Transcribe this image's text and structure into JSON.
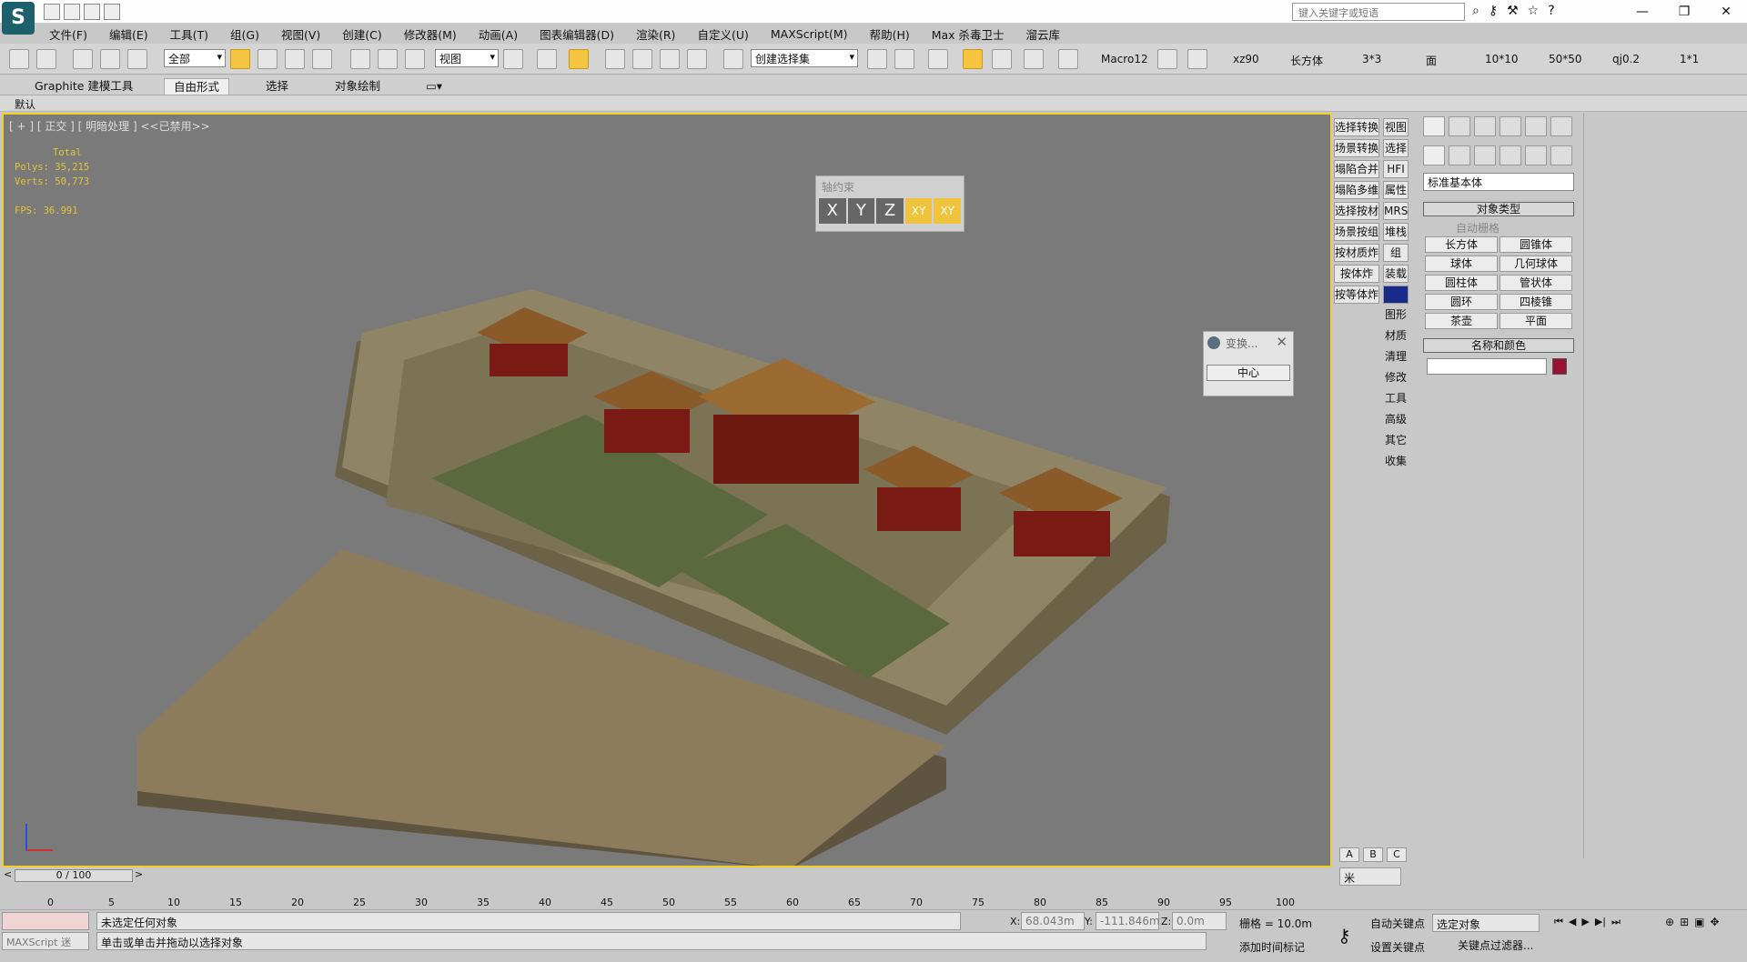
{
  "app": {
    "search_placeholder": "键入关键字或短语"
  },
  "menu": [
    "文件(F)",
    "编辑(E)",
    "工具(T)",
    "组(G)",
    "视图(V)",
    "创建(C)",
    "修改器(M)",
    "动画(A)",
    "图表编辑器(D)",
    "渲染(R)",
    "自定义(U)",
    "MAXScript(M)",
    "帮助(H)",
    "Max 杀毒卫士",
    "溜云库"
  ],
  "toolbar": {
    "selection_filter": "全部",
    "ref_coord": "视图",
    "named_selection": "创建选择集",
    "macros": [
      "Macro12",
      "xz90",
      "长方体",
      "3*3",
      "面",
      "10*10",
      "50*50",
      "qj0.2",
      "1*1"
    ]
  },
  "ribbon": {
    "tabs": [
      "Graphite 建模工具",
      "自由形式",
      "选择",
      "对象绘制"
    ]
  },
  "subbar": {
    "label": "默认"
  },
  "viewport": {
    "label": "[ + ] [ 正交 ] [ 明暗处理 ] <<已禁用>>",
    "stats": {
      "total": "Total",
      "polys": "Polys: 35,215",
      "verts": "Verts: 50,773",
      "fps": "FPS:   36.991"
    }
  },
  "axis_constraint": {
    "title": "轴约束",
    "x": "X",
    "y": "Y",
    "z": "Z",
    "xy": "XY",
    "xy2": "XY"
  },
  "transform": {
    "title": "变换...",
    "center_button": "中心"
  },
  "script_buttons_left": [
    "选择转换",
    "场景转换",
    "塌陷合并",
    "塌陷多维",
    "选择按材",
    "场景按组",
    "按材质炸",
    "按体炸",
    "按等体炸"
  ],
  "script_buttons_right": [
    "视图",
    "选择",
    "HFI",
    "属性",
    "MRS",
    "堆栈",
    "组",
    "装载",
    "",
    "图形",
    "材质",
    "清理",
    "修改",
    "工具",
    "高级",
    "其它",
    "收集"
  ],
  "abc": [
    "A",
    "B",
    "C"
  ],
  "unit": "米",
  "cmd_panel": {
    "dropdown": "标准基本体",
    "object_type_header": "对象类型",
    "auto_grid": "自动栅格",
    "primitives": [
      "长方体",
      "圆锥体",
      "球体",
      "几何球体",
      "圆柱体",
      "管状体",
      "圆环",
      "四棱锥",
      "茶壶",
      "平面"
    ],
    "name_color_header": "名称和颜色",
    "color": "#9a1030"
  },
  "timeline": {
    "frame": "0 / 100",
    "ticks": [
      "0",
      "5",
      "10",
      "15",
      "20",
      "25",
      "30",
      "35",
      "40",
      "45",
      "50",
      "55",
      "60",
      "65",
      "70",
      "75",
      "80",
      "85",
      "90",
      "95",
      "100"
    ]
  },
  "status": {
    "listener": "MAXScript 迷",
    "msg1": "未选定任何对象",
    "msg2": "单击或单击并拖动以选择对象",
    "x_label": "X:",
    "x": "68.043m",
    "y_label": "Y:",
    "y": "-111.846m",
    "z_label": "Z:",
    "z": "0.0m",
    "grid": "栅格 = 10.0m",
    "autokey": "自动关键点",
    "setkey": "设置关键点",
    "selected": "选定对象",
    "key_filter": "关键点过滤器...",
    "add_time_tag": "添加时间标记"
  }
}
